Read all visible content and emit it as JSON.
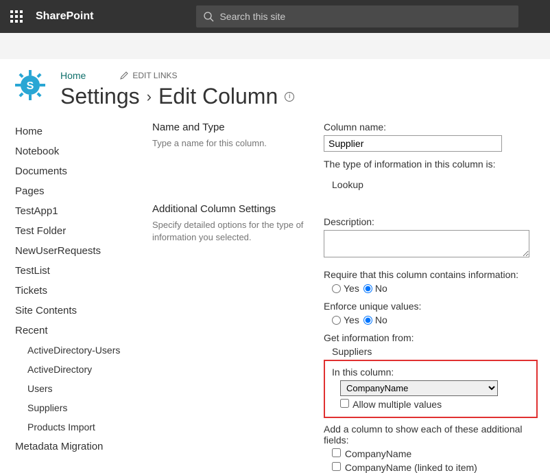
{
  "topbar": {
    "brand": "SharePoint",
    "search_placeholder": "Search this site"
  },
  "breadcrumb": {
    "home": "Home",
    "edit_links": "EDIT LINKS"
  },
  "title": {
    "settings": "Settings",
    "page": "Edit Column"
  },
  "quick_launch": {
    "items": [
      "Home",
      "Notebook",
      "Documents",
      "Pages",
      "TestApp1",
      "Test Folder",
      "NewUserRequests",
      "TestList",
      "Tickets",
      "Site Contents"
    ],
    "recent_header": "Recent",
    "recent": [
      "ActiveDirectory-Users",
      "ActiveDirectory",
      "Users",
      "Suppliers",
      "Products Import"
    ],
    "metadata": "Metadata Migration"
  },
  "section1": {
    "title": "Name and Type",
    "desc": "Type a name for this column."
  },
  "section2": {
    "title": "Additional Column Settings",
    "desc": "Specify detailed options for the type of information you selected."
  },
  "form": {
    "col_name_label": "Column name:",
    "col_name_value": "Supplier",
    "type_label": "The type of information in this column is:",
    "type_value": "Lookup",
    "desc_label": "Description:",
    "desc_value": "",
    "require_label": "Require that this column contains information:",
    "enforce_label": "Enforce unique values:",
    "yes": "Yes",
    "no": "No",
    "getinfo_label": "Get information from:",
    "getinfo_value": "Suppliers",
    "inthis_label": "In this column:",
    "inthis_value": "CompanyName",
    "allow_multi": "Allow multiple values",
    "addcol_label": "Add a column to show each of these additional fields:",
    "addcol_1": "CompanyName",
    "addcol_2": "CompanyName (linked to item)"
  }
}
